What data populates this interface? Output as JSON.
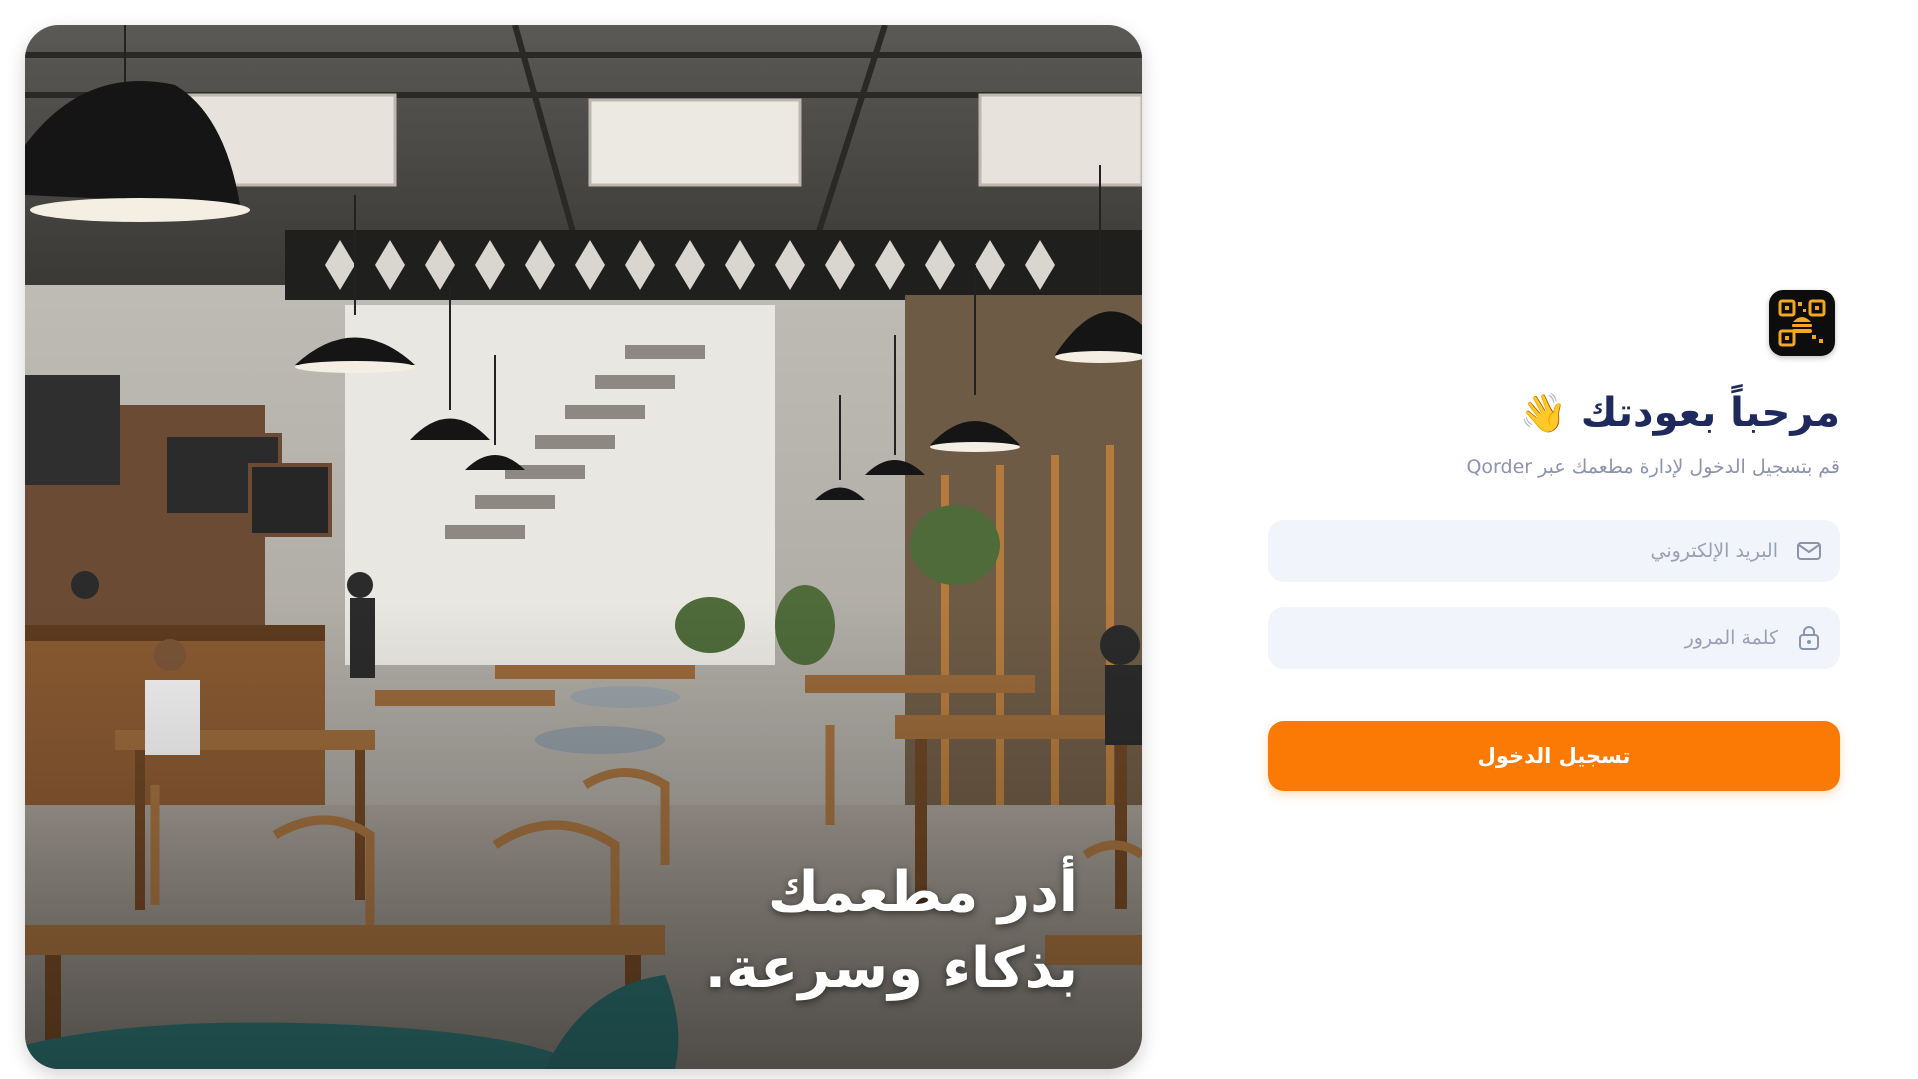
{
  "hero": {
    "headline_line1": "أدر مطعمك",
    "headline_line2": "بذكاء وسرعة."
  },
  "login": {
    "title": "مرحباً بعودتك",
    "wave_emoji": "👋",
    "subtitle": "قم بتسجيل الدخول لإدارة مطعمك عبر Qorder",
    "email_placeholder": "البريد الإلكتروني",
    "password_placeholder": "كلمة المرور",
    "submit_label": "تسجيل الدخول",
    "email_icon": "mail-icon",
    "password_icon": "lock-icon",
    "logo_icon": "qr-burger-logo-icon"
  },
  "colors": {
    "accent": "#fb7a06",
    "title": "#1e2a5c",
    "subtitle": "#8b93ad",
    "field_bg": "#f1f4fb"
  }
}
